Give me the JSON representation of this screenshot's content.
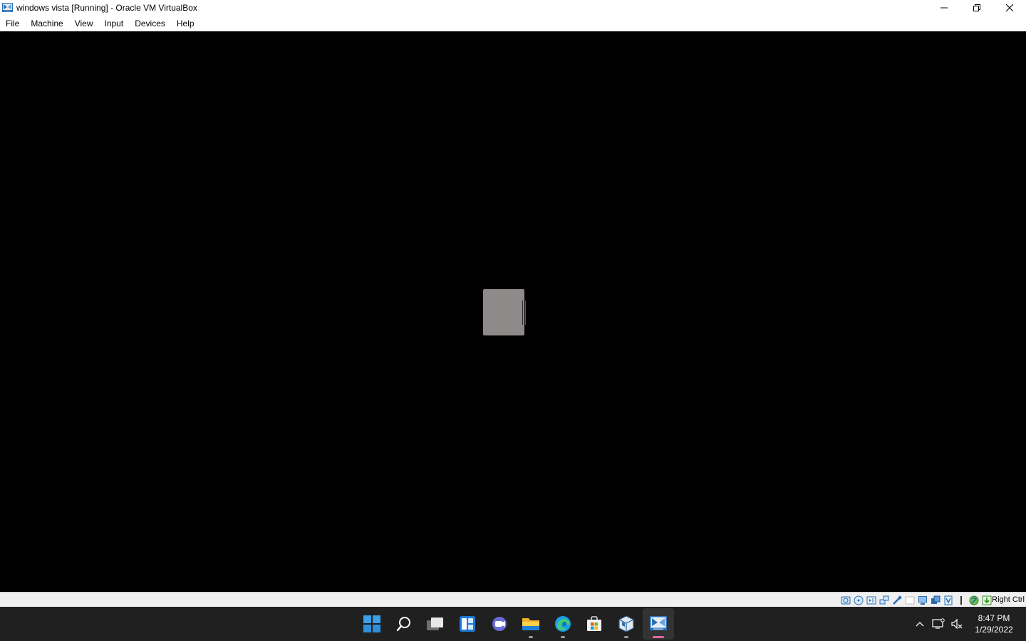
{
  "window": {
    "title": "windows vista [Running] - Oracle VM VirtualBox",
    "icon": "virtualbox-vm-icon"
  },
  "window_controls": [
    {
      "name": "minimize-button",
      "icon": "minimize-icon"
    },
    {
      "name": "restore-button",
      "icon": "restore-icon"
    },
    {
      "name": "close-button",
      "icon": "close-icon"
    }
  ],
  "menu": {
    "items": [
      "File",
      "Machine",
      "View",
      "Input",
      "Devices",
      "Help"
    ]
  },
  "statusbar": {
    "indicators": [
      "hard-disk-icon",
      "optical-drive-icon",
      "audio-icon",
      "network-icon",
      "usb-icon",
      "shared-folders-icon",
      "display-icon",
      "recording-icon",
      "video-capture-icon",
      "cpu-icon",
      "mouse-integration-icon",
      "keyboard-capture-icon"
    ],
    "host_key": "Right Ctrl"
  },
  "taskbar": {
    "apps": [
      {
        "name": "start",
        "icon": "windows-logo-icon",
        "running": false,
        "active": false
      },
      {
        "name": "search",
        "icon": "search-icon",
        "running": false,
        "active": false
      },
      {
        "name": "task-view",
        "icon": "task-view-icon",
        "running": false,
        "active": false
      },
      {
        "name": "widgets",
        "icon": "widgets-icon",
        "running": false,
        "active": false
      },
      {
        "name": "chat",
        "icon": "teams-chat-icon",
        "running": false,
        "active": false
      },
      {
        "name": "file-explorer",
        "icon": "folder-icon",
        "running": true,
        "active": false
      },
      {
        "name": "edge",
        "icon": "edge-browser-icon",
        "running": true,
        "active": false
      },
      {
        "name": "microsoft-store",
        "icon": "store-bag-icon",
        "running": false,
        "active": false
      },
      {
        "name": "virtualbox-manager",
        "icon": "virtualbox-cube-icon",
        "running": true,
        "active": false
      },
      {
        "name": "virtualbox-vm",
        "icon": "virtualbox-vm-icon",
        "running": true,
        "active": true
      }
    ],
    "tray": {
      "icons": [
        "chevron-up-icon",
        "network-monitor-icon",
        "speaker-muted-icon"
      ],
      "time": "8:47 PM",
      "date": "1/29/2022"
    }
  },
  "colors": {
    "titlebar_bg": "#ffffff",
    "vm_bg": "#000000",
    "statusbar_bg": "#f0f0f0",
    "taskbar_bg": "#202020",
    "windows_blue": "#3a9bdc",
    "active_indicator": "#e06aa7"
  }
}
